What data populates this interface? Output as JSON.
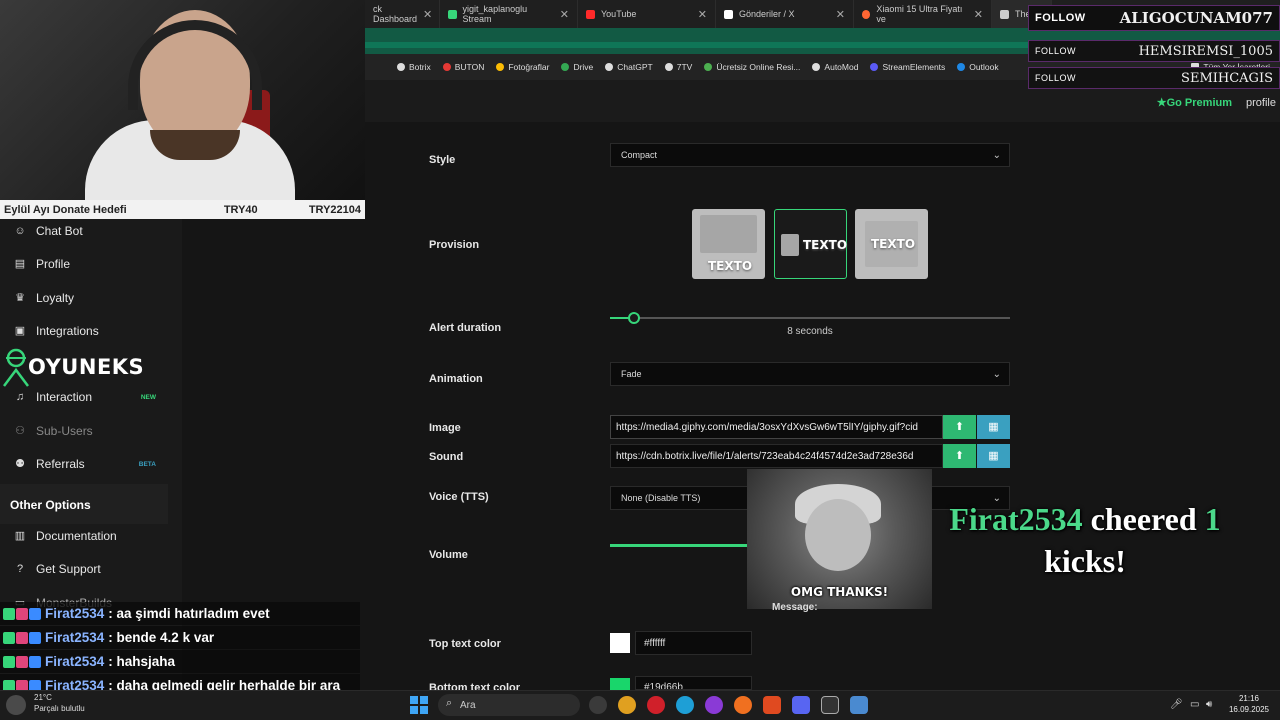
{
  "donate_bar": {
    "title": "Eylül Ayı Donate Hedefi",
    "current": "TRY40",
    "target": "TRY22104"
  },
  "tabs": [
    {
      "label": "ck Dashboard",
      "color": "#37d67a"
    },
    {
      "label": "yigit_kaplanoglu Stream",
      "color": "#37d67a"
    },
    {
      "label": "YouTube",
      "color": "#ff2a2a"
    },
    {
      "label": "Gönderiler / X",
      "color": "#ffffff"
    },
    {
      "label": "Xiaomi 15 Ultra Fiyatı ve",
      "color": "#ff6633"
    },
    {
      "label": "The",
      "color": "#cccccc"
    }
  ],
  "bookmarks": [
    {
      "label": "Botrix",
      "color": "#dddddd"
    },
    {
      "label": "BUTON",
      "color": "#e53935"
    },
    {
      "label": "Fotoğraflar",
      "color": "#fbbc04"
    },
    {
      "label": "Drive",
      "color": "#34a853"
    },
    {
      "label": "ChatGPT",
      "color": "#dddddd"
    },
    {
      "label": "7TV",
      "color": "#dddddd"
    },
    {
      "label": "Ücretsiz Online Resi...",
      "color": "#4caf50"
    },
    {
      "label": "AutoMod",
      "color": "#dddddd"
    },
    {
      "label": "StreamElements",
      "color": "#5a5af5"
    },
    {
      "label": "Outlook",
      "color": "#1e88e5"
    },
    {
      "label": "Tüm Yer İşaretleri",
      "color": "#dddddd"
    }
  ],
  "header": {
    "go_premium": "Go Premium",
    "profile": "profile"
  },
  "follow_overlay": [
    {
      "label": "FOLLOW",
      "name": "ALIGOCUNAM077"
    },
    {
      "label": "FOLLOW",
      "name": "HEMSIREMSI_1005"
    },
    {
      "label": "FOLLOW",
      "name": "SEMIHCAGIS"
    }
  ],
  "sidebar": {
    "items": [
      {
        "label": "Chat Bot",
        "icon": "robot-icon"
      },
      {
        "label": "Profile",
        "icon": "id-card-icon"
      },
      {
        "label": "Loyalty",
        "icon": "trophy-icon"
      },
      {
        "label": "Integrations",
        "icon": "link-icon"
      },
      {
        "label": "Interaction",
        "icon": "music-note-icon",
        "badge": "NEW"
      },
      {
        "label": "Sub-Users",
        "icon": "users-icon"
      },
      {
        "label": "Referrals",
        "icon": "referrals-icon",
        "badge": "BETA"
      }
    ],
    "section_title": "Other Options",
    "other_items": [
      {
        "label": "Documentation",
        "icon": "book-icon"
      },
      {
        "label": "Get Support",
        "icon": "help-icon"
      },
      {
        "label": "MonsterBuilds",
        "icon": "monitor-icon"
      }
    ]
  },
  "brand": {
    "name": "OYUNEKS"
  },
  "form": {
    "style": {
      "label": "Style",
      "value": "Compact"
    },
    "provision": {
      "label": "Provision",
      "options": [
        "TEXTO",
        "TEXTO",
        "TEXTO"
      ],
      "selected_index": 1
    },
    "alert_duration": {
      "label": "Alert duration",
      "value_text": "8 seconds",
      "fraction": 0.06
    },
    "animation": {
      "label": "Animation",
      "value": "Fade"
    },
    "image": {
      "label": "Image",
      "value": "https://media4.giphy.com/media/3osxYdXvsGw6wT5lIY/giphy.gif?cid"
    },
    "sound": {
      "label": "Sound",
      "value": "https://cdn.botrix.live/file/1/alerts/723eab4c24f4574d2e3ad728e36d"
    },
    "voice": {
      "label": "Voice (TTS)",
      "value": "None (Disable TTS)"
    },
    "volume": {
      "label": "Volume"
    },
    "message": {
      "label": "Message:"
    },
    "top_text_color": {
      "label": "Top text color",
      "value": "#ffffff"
    },
    "bottom_text_color": {
      "label": "Bottom text color",
      "value": "#19d66b"
    }
  },
  "gif_overlay": {
    "caption": "OMG THANKS!"
  },
  "cheer_alert": {
    "user": "Firat2534",
    "text1": "cheered",
    "amount": "1",
    "text2": "kicks!"
  },
  "chat": [
    {
      "user": "Firat2534",
      "message": ": aa şimdi hatırladım evet"
    },
    {
      "user": "Firat2534",
      "message": ": bende 4.2 k var"
    },
    {
      "user": "Firat2534",
      "message": ": hahsjaha"
    },
    {
      "user": "Firat2534",
      "message": ": daha gelmedi gelir herhalde bir ara"
    }
  ],
  "taskbar": {
    "weather_temp": "21°C",
    "weather_desc": "Parçalı bulutlu",
    "search_placeholder": "Ara",
    "time": "21:16",
    "date": "16.09.2025"
  }
}
